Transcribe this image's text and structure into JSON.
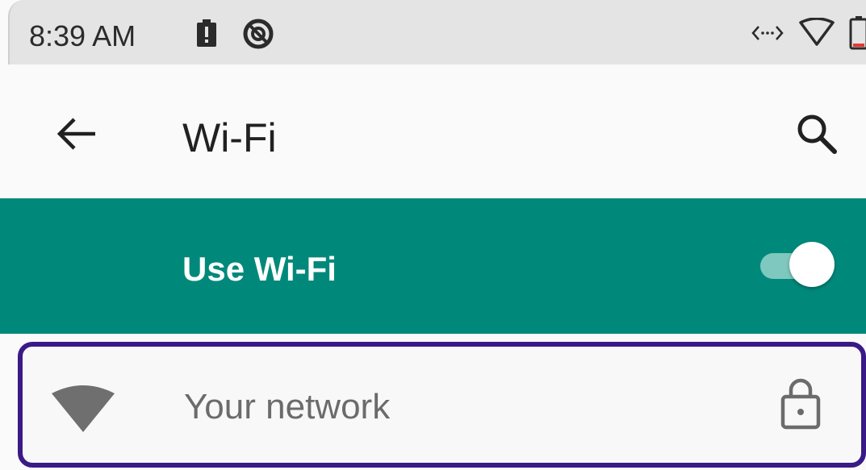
{
  "status_bar": {
    "time": "8:39 AM",
    "icons": [
      "battery-alert-icon",
      "sync-off-icon",
      "data-arrows-icon",
      "wifi-outline-icon",
      "battery-icon"
    ]
  },
  "app_bar": {
    "title": "Wi-Fi",
    "back_icon": "arrow-back-icon",
    "search_icon": "search-icon"
  },
  "wifi_master": {
    "label": "Use Wi-Fi",
    "enabled": true
  },
  "networks": [
    {
      "name": "Your network",
      "secured": true
    }
  ],
  "colors": {
    "accent": "#00897b",
    "highlight_border": "#3a1a86"
  }
}
